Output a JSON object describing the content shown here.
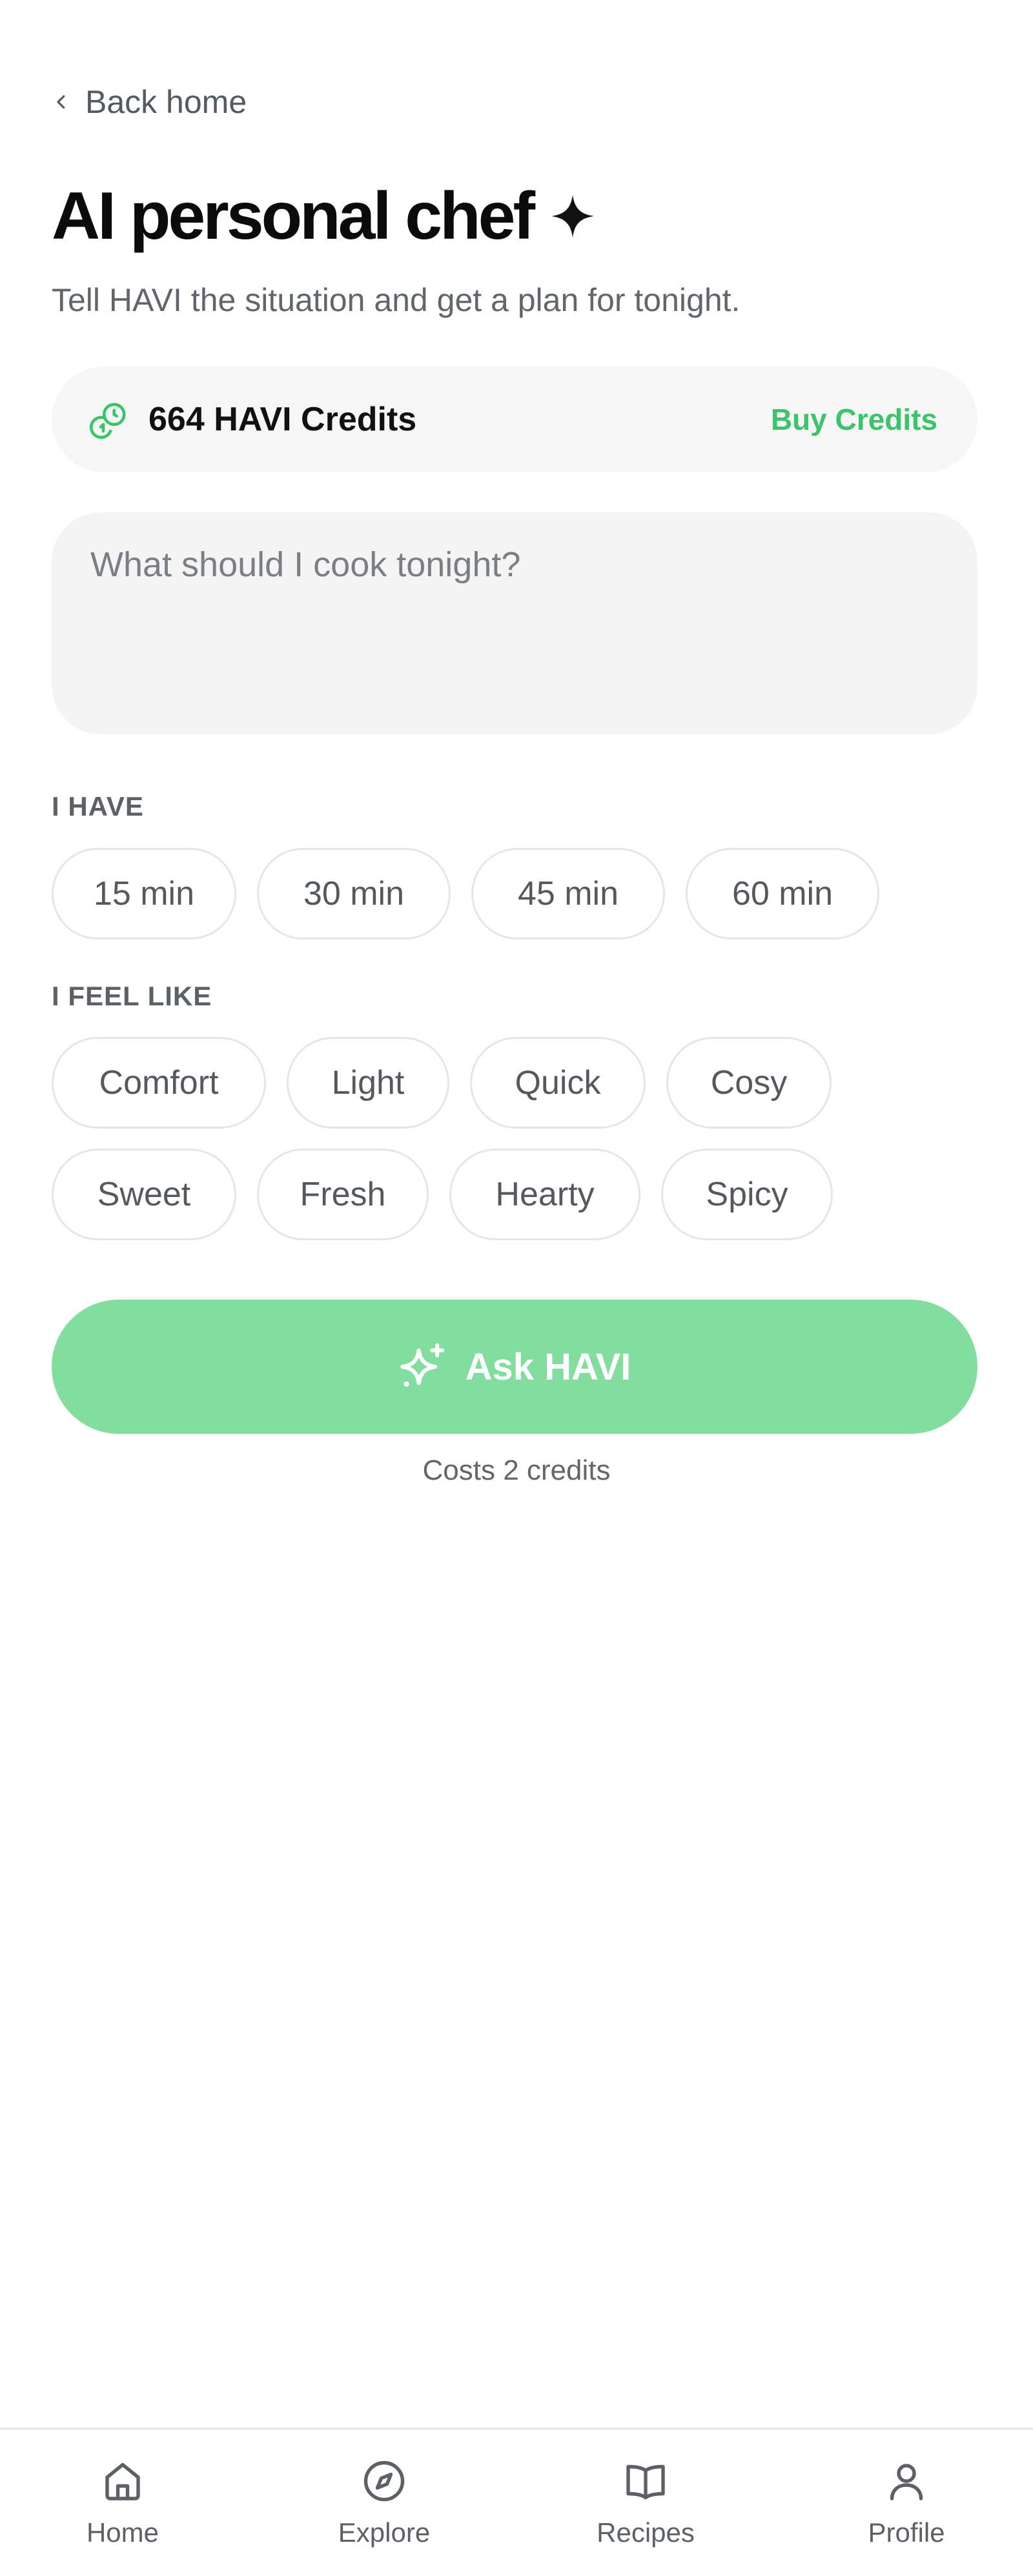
{
  "back": {
    "label": "Back home"
  },
  "header": {
    "title": "AI personal chef",
    "subtitle": "Tell HAVI the situation and get a plan for tonight."
  },
  "credits": {
    "label": "664 HAVI Credits",
    "buy_label": "Buy Credits"
  },
  "prompt": {
    "value": "",
    "placeholder": "What should I cook tonight?"
  },
  "time_section": {
    "label": "I HAVE",
    "options": [
      "15 min",
      "30 min",
      "45 min",
      "60 min"
    ]
  },
  "mood_section": {
    "label": "I FEEL LIKE",
    "options": [
      "Comfort",
      "Light",
      "Quick",
      "Cosy",
      "Sweet",
      "Fresh",
      "Hearty",
      "Spicy"
    ]
  },
  "ask_button": {
    "label": "Ask HAVI",
    "cost": "Costs 2 credits"
  },
  "nav": {
    "items": [
      {
        "label": "Home",
        "icon": "home-icon"
      },
      {
        "label": "Explore",
        "icon": "compass-icon"
      },
      {
        "label": "Recipes",
        "icon": "book-icon"
      },
      {
        "label": "Profile",
        "icon": "user-icon"
      }
    ]
  },
  "colors": {
    "accent": "#3cc46a",
    "button": "#83dd9f",
    "card": "#f6f6f6",
    "text": "#111111",
    "muted": "#62666a"
  }
}
